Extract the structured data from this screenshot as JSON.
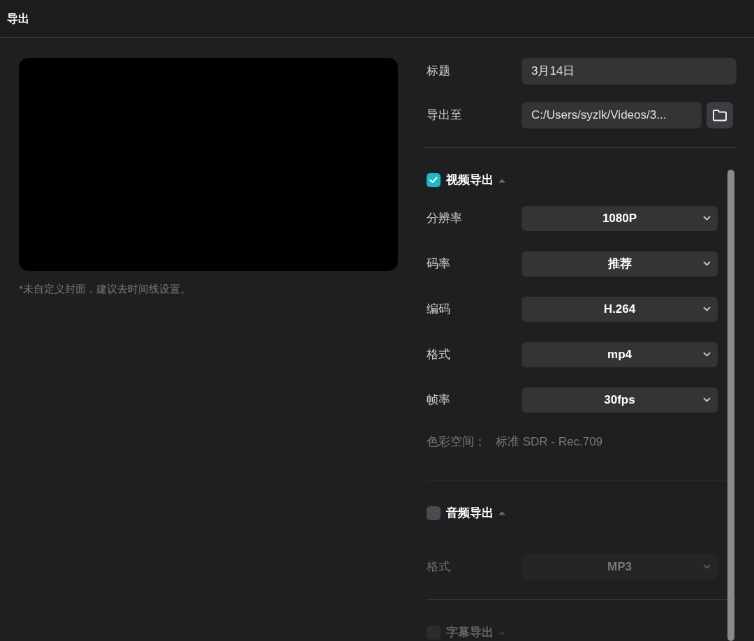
{
  "window": {
    "title": "导出"
  },
  "cover_hint": "*未自定义封面，建议去时间线设置。",
  "fields": [
    {
      "kind": "text",
      "label": "标题",
      "value": "3月14日"
    },
    {
      "kind": "path",
      "label": "导出至",
      "value": "C:/Users/syzlk/Videos/3..."
    }
  ],
  "sections": [
    {
      "title": "视频导出",
      "checked": true,
      "disabled": false,
      "settings": [
        {
          "label": "分辨率",
          "value": "1080P",
          "disabled": false
        },
        {
          "label": "码率",
          "value": "推荐",
          "disabled": false
        },
        {
          "label": "编码",
          "value": "H.264",
          "disabled": false
        },
        {
          "label": "格式",
          "value": "mp4",
          "disabled": false
        },
        {
          "label": "帧率",
          "value": "30fps",
          "disabled": false
        }
      ],
      "note_label": "色彩空间：",
      "note_value": "标准 SDR - Rec.709"
    },
    {
      "title": "音频导出",
      "checked": false,
      "disabled": false,
      "settings": [
        {
          "label": "格式",
          "value": "MP3",
          "disabled": true
        }
      ]
    },
    {
      "title": "字幕导出",
      "checked": false,
      "disabled": true
    }
  ]
}
